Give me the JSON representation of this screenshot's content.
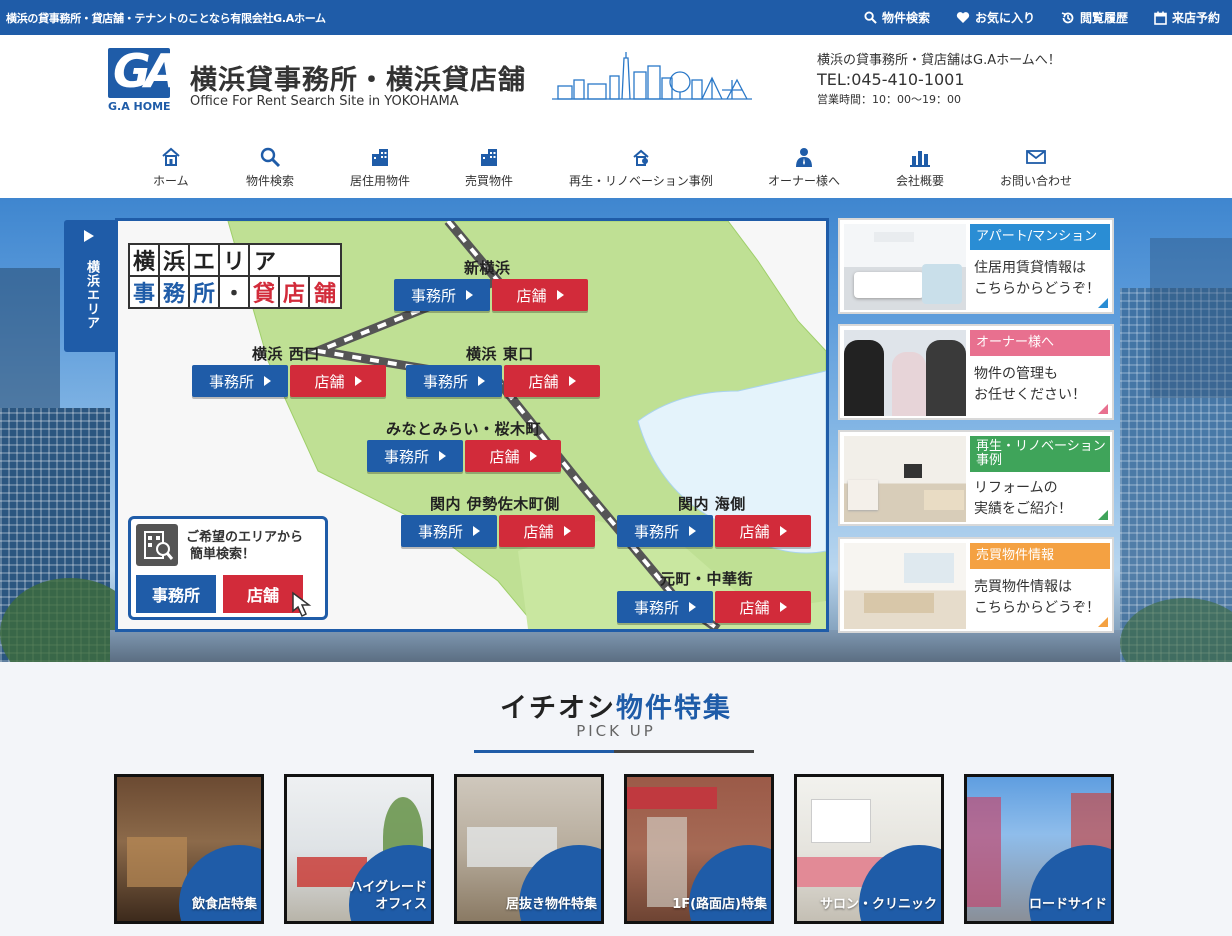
{
  "topbar": {
    "tagline": "横浜の貸事務所・貸店舗・テナントのことなら有限会社G.Aホーム",
    "links": [
      {
        "label": "物件検索",
        "icon": "search-icon"
      },
      {
        "label": "お気に入り",
        "icon": "heart-icon"
      },
      {
        "label": "閲覧履歴",
        "icon": "history-icon"
      },
      {
        "label": "来店予約",
        "icon": "calendar-icon"
      }
    ]
  },
  "header": {
    "logo_mark": "GA",
    "logo_text": "G.A HOME",
    "title": "横浜貸事務所・横浜貸店舗",
    "subtitle": "Office For Rent Search Site in YOKOHAMA",
    "info_line": "横浜の貸事務所・貸店舗はG.Aホームへ！",
    "tel": "TEL:045-410-1001",
    "hours": "営業時間：10：00〜19：00"
  },
  "nav": [
    {
      "label": "ホーム",
      "icon": "home-icon"
    },
    {
      "label": "物件検索",
      "icon": "search-icon"
    },
    {
      "label": "居住用物件",
      "icon": "building-icon"
    },
    {
      "label": "売買物件",
      "icon": "building-icon"
    },
    {
      "label": "再生・リノベーション事例",
      "icon": "renovation-icon"
    },
    {
      "label": "オーナー様へ",
      "icon": "person-icon"
    },
    {
      "label": "会社概要",
      "icon": "company-icon"
    },
    {
      "label": "お問い合わせ",
      "icon": "mail-icon"
    }
  ],
  "hero": {
    "area_tab": "横浜エリア",
    "map_title_row1": [
      "横",
      "浜",
      "エ",
      "リ",
      "ア"
    ],
    "map_title_row2": [
      "事",
      "務",
      "所",
      "・",
      "貸",
      "店",
      "舗"
    ],
    "office_label": "事務所",
    "shop_label": "店舗",
    "areas": [
      {
        "name": "新横浜"
      },
      {
        "name": "横浜 西口"
      },
      {
        "name": "横浜 東口"
      },
      {
        "name": "みなとみらい・桜木町"
      },
      {
        "name": "関内 伊勢佐木町側"
      },
      {
        "name": "関内 海側"
      },
      {
        "name": "元町・中華街"
      }
    ],
    "easy_search": {
      "text_line1": "ご希望のエリアから",
      "text_line2": "簡単検索！",
      "office": "事務所",
      "shop": "店舗"
    }
  },
  "side_cards": [
    {
      "label": "アパート/マンション",
      "color": "#2a8dd4",
      "line1": "住居用賃貸情報は",
      "line2": "こちらからどうぞ！"
    },
    {
      "label": "オーナー様へ",
      "color": "#e8708f",
      "line1": "物件の管理も",
      "line2": "お任せください！"
    },
    {
      "label": "再生・リノベーション事例",
      "color": "#3fa45a",
      "line1": "リフォームの",
      "line2": "実績をご紹介！"
    },
    {
      "label": "売買物件情報",
      "color": "#f4a142",
      "line1": "売買物件情報は",
      "line2": "こちらからどうぞ！"
    }
  ],
  "pickup": {
    "title_black": "イチオシ",
    "title_blue": "物件特集",
    "subtitle": "PICK UP",
    "items": [
      {
        "label": "飲食店特集"
      },
      {
        "label": "ハイグレード\nオフィス"
      },
      {
        "label": "居抜き物件特集"
      },
      {
        "label": "1F(路面店)特集"
      },
      {
        "label": "サロン・クリニック"
      },
      {
        "label": "ロードサイド"
      }
    ]
  },
  "colors": {
    "primary": "#1f5ca8",
    "shop_red": "#d22b3a",
    "map_green": "#b9dc8f",
    "sea_blue": "#dff0fb"
  }
}
